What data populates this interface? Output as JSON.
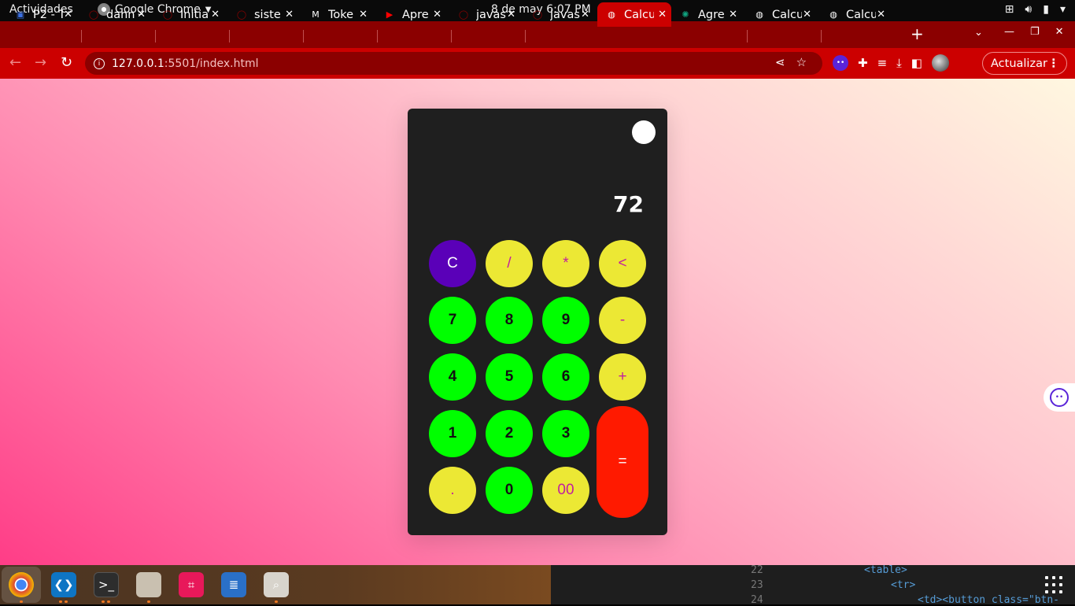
{
  "topbar": {
    "activities": "Actividades",
    "app_name": "Google Chrome",
    "clock": "8 de may  6:07 PM"
  },
  "tabs": [
    {
      "title": "P2 - T",
      "icon": "contacts-icon",
      "color": "#3b6fe0"
    },
    {
      "title": "dann",
      "icon": "github-icon",
      "color": "#8b0000"
    },
    {
      "title": "Initia",
      "icon": "github-icon",
      "color": "#8b0000"
    },
    {
      "title": "siste",
      "icon": "github-icon",
      "color": "#8b0000"
    },
    {
      "title": "Toke",
      "icon": "gmail-icon",
      "color": "#ffffff"
    },
    {
      "title": "Apre",
      "icon": "youtube-icon",
      "color": "#ff0000"
    },
    {
      "title": "javas",
      "icon": "github-icon",
      "color": "#8b0000"
    },
    {
      "title": "javas",
      "icon": "github-icon",
      "color": "#8b0000"
    },
    {
      "title": "Calcu",
      "icon": "globe-icon",
      "color": "#ffffff",
      "active": true
    },
    {
      "title": "Agre",
      "icon": "chatgpt-icon",
      "color": "#10a37f"
    },
    {
      "title": "Calcu",
      "icon": "globe-icon",
      "color": "#ffffff"
    },
    {
      "title": "Calcu",
      "icon": "globe-icon",
      "color": "#ffffff"
    }
  ],
  "toolbar": {
    "url_host": "127.0.0.1",
    "url_path": ":5501/index.html",
    "update_label": "Actualizar"
  },
  "calculator": {
    "display": "72",
    "keys": {
      "clear": "C",
      "divide": "/",
      "multiply": "*",
      "backspace": "<",
      "seven": "7",
      "eight": "8",
      "nine": "9",
      "minus": "-",
      "four": "4",
      "five": "5",
      "six": "6",
      "plus": "+",
      "one": "1",
      "two": "2",
      "three": "3",
      "equals": "=",
      "dot": ".",
      "zero": "0",
      "double_zero": "00"
    },
    "colors": {
      "operator": "#ece834",
      "number": "#00ff00",
      "clear": "#5a00b8",
      "equals": "#ff1a00",
      "body": "#1f1f1f"
    }
  },
  "dock": {
    "apps": [
      "chrome-icon",
      "vscode-icon",
      "terminal-icon",
      "files-icon",
      "screenshot-icon",
      "text-editor-icon",
      "image-viewer-icon"
    ],
    "code_lines": [
      {
        "num": "22",
        "code": "<table>"
      },
      {
        "num": "23",
        "code": "<tr>"
      },
      {
        "num": "24",
        "code": "<td><button class=\"btn-"
      }
    ]
  }
}
